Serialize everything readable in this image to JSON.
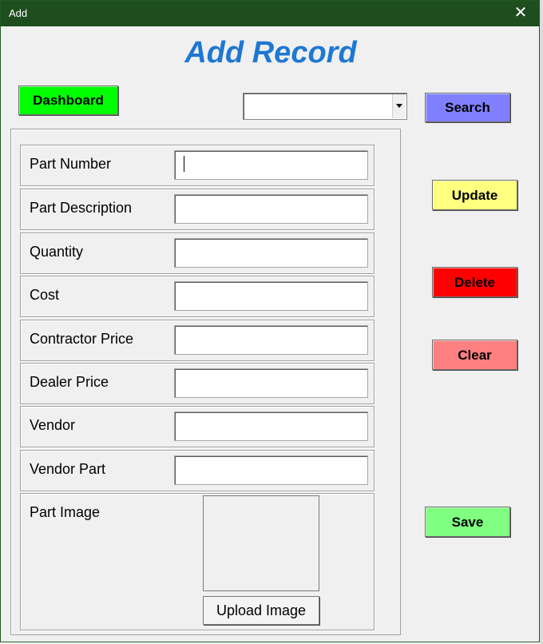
{
  "window": {
    "title": "Add",
    "close_glyph": "✕"
  },
  "form": {
    "heading": "Add Record"
  },
  "toolbar": {
    "dashboard_label": "Dashboard",
    "search_label": "Search",
    "search_combo_value": ""
  },
  "fields": [
    {
      "label": "Part Number",
      "value": ""
    },
    {
      "label": "Part Description",
      "value": ""
    },
    {
      "label": "Quantity",
      "value": ""
    },
    {
      "label": "Cost",
      "value": ""
    },
    {
      "label": "Contractor Price",
      "value": ""
    },
    {
      "label": "Dealer Price",
      "value": ""
    },
    {
      "label": "Vendor",
      "value": ""
    },
    {
      "label": "Vendor Part",
      "value": ""
    }
  ],
  "image_section": {
    "label": "Part Image",
    "upload_label": "Upload Image"
  },
  "actions": {
    "update_label": "Update",
    "delete_label": "Delete",
    "clear_label": "Clear",
    "save_label": "Save"
  },
  "colors": {
    "titlebar": "#1e4d1e",
    "heading": "#1e78d2",
    "dashboard": "#00ff00",
    "search": "#8080ff",
    "update": "#ffff80",
    "delete": "#ff0000",
    "clear": "#ff8080",
    "save": "#80ff80"
  }
}
